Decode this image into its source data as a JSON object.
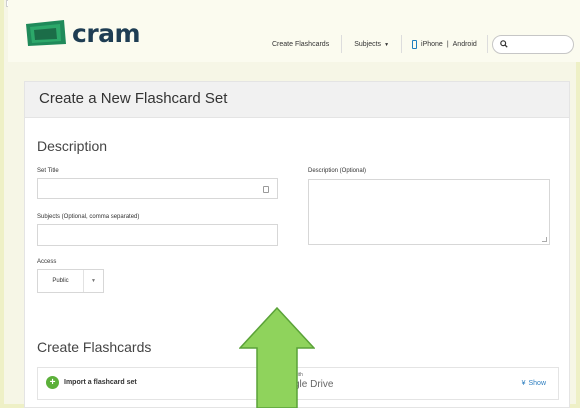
{
  "header": {
    "logo_text": "cram",
    "nav": {
      "create": "Create Flashcards",
      "subjects": "Subjects",
      "iphone": "iPhone",
      "divider": "|",
      "android": "Android"
    },
    "search_placeholder": ""
  },
  "card": {
    "title": "Create a New Flashcard Set"
  },
  "description": {
    "heading": "Description",
    "set_title_label": "Set Title",
    "set_title_value": "",
    "subjects_label": "Subjects (Optional, comma separated)",
    "subjects_value": "",
    "access_label": "Access",
    "access_value": "Public",
    "desc_label": "Description (Optional)",
    "desc_value": ""
  },
  "create": {
    "heading": "Create Flashcards",
    "import_label": "Import a flashcard set",
    "drive_with": "with",
    "drive_name": "gle Drive",
    "show_label": "Show"
  },
  "colors": {
    "accent_green": "#5cb03a",
    "arrow_green": "#8fd35c",
    "link_blue": "#2e7fc0"
  }
}
